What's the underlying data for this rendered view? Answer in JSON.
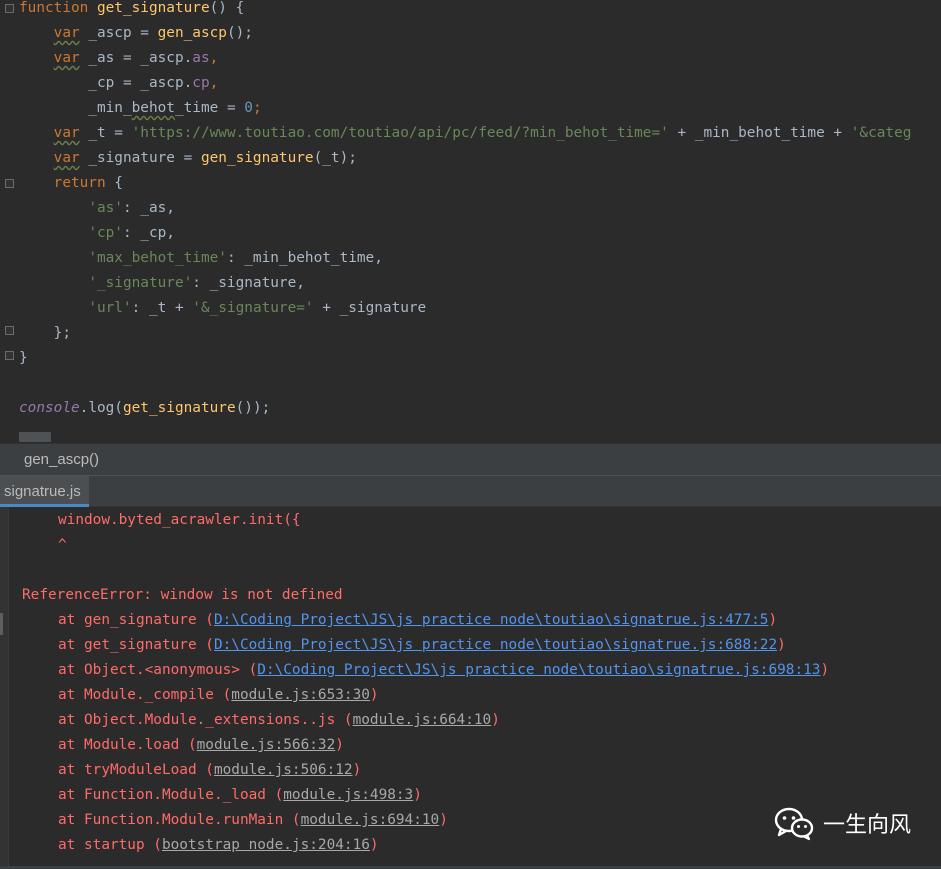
{
  "editor": {
    "lines": [
      {
        "parts": [
          {
            "t": "function ",
            "c": "kw"
          },
          {
            "t": "get_signature",
            "c": "fn"
          },
          {
            "t": "() {",
            "c": ""
          }
        ]
      },
      {
        "parts": [
          {
            "t": "    ",
            "c": ""
          },
          {
            "t": "var",
            "c": "kw wavy"
          },
          {
            "t": " _ascp = ",
            "c": ""
          },
          {
            "t": "gen_ascp",
            "c": "fn"
          },
          {
            "t": "();",
            "c": ""
          }
        ]
      },
      {
        "parts": [
          {
            "t": "    ",
            "c": ""
          },
          {
            "t": "var",
            "c": "kw wavy"
          },
          {
            "t": " _as = _ascp.",
            "c": ""
          },
          {
            "t": "as",
            "c": "prop"
          },
          {
            "t": ",",
            "c": "kw"
          }
        ]
      },
      {
        "parts": [
          {
            "t": "        _cp = _ascp.",
            "c": ""
          },
          {
            "t": "cp",
            "c": "prop"
          },
          {
            "t": ",",
            "c": "kw"
          }
        ]
      },
      {
        "parts": [
          {
            "t": "        _min_",
            "c": ""
          },
          {
            "t": "behot",
            "c": "wavy"
          },
          {
            "t": "_time = ",
            "c": ""
          },
          {
            "t": "0",
            "c": "num"
          },
          {
            "t": ";",
            "c": "kw"
          }
        ]
      },
      {
        "parts": [
          {
            "t": "    ",
            "c": ""
          },
          {
            "t": "var",
            "c": "kw wavy"
          },
          {
            "t": " _t = ",
            "c": ""
          },
          {
            "t": "'https://www.toutiao.com/toutiao/api/pc/feed/?min_behot_time='",
            "c": "str"
          },
          {
            "t": " + _min_behot_time + ",
            "c": ""
          },
          {
            "t": "'&categ",
            "c": "str"
          }
        ]
      },
      {
        "parts": [
          {
            "t": "    ",
            "c": ""
          },
          {
            "t": "var",
            "c": "kw wavy"
          },
          {
            "t": " _signature = ",
            "c": ""
          },
          {
            "t": "gen_signature",
            "c": "fn"
          },
          {
            "t": "(_t);",
            "c": ""
          }
        ]
      },
      {
        "parts": [
          {
            "t": "    ",
            "c": ""
          },
          {
            "t": "return",
            "c": "kw"
          },
          {
            "t": " {",
            "c": ""
          }
        ]
      },
      {
        "parts": [
          {
            "t": "        ",
            "c": ""
          },
          {
            "t": "'as'",
            "c": "str"
          },
          {
            "t": ": _as,",
            "c": ""
          }
        ]
      },
      {
        "parts": [
          {
            "t": "        ",
            "c": ""
          },
          {
            "t": "'cp'",
            "c": "str"
          },
          {
            "t": ": _cp,",
            "c": ""
          }
        ]
      },
      {
        "parts": [
          {
            "t": "        ",
            "c": ""
          },
          {
            "t": "'max_behot_time'",
            "c": "str"
          },
          {
            "t": ": _min_behot_time,",
            "c": ""
          }
        ]
      },
      {
        "parts": [
          {
            "t": "        ",
            "c": ""
          },
          {
            "t": "'_signature'",
            "c": "str"
          },
          {
            "t": ": _signature,",
            "c": ""
          }
        ]
      },
      {
        "parts": [
          {
            "t": "        ",
            "c": ""
          },
          {
            "t": "'url'",
            "c": "str"
          },
          {
            "t": ": _t + ",
            "c": ""
          },
          {
            "t": "'&_signature='",
            "c": "str"
          },
          {
            "t": " + _signature",
            "c": ""
          }
        ]
      },
      {
        "parts": [
          {
            "t": "    };",
            "c": ""
          }
        ]
      },
      {
        "parts": [
          {
            "t": "}",
            "c": ""
          }
        ]
      },
      {
        "parts": [
          {
            "t": "",
            "c": ""
          }
        ]
      },
      {
        "parts": [
          {
            "t": "console",
            "c": "con"
          },
          {
            "t": ".log(",
            "c": ""
          },
          {
            "t": "get_signature",
            "c": "fn"
          },
          {
            "t": "());",
            "c": ""
          }
        ]
      }
    ]
  },
  "breadcrumb": {
    "label": "gen_ascp()"
  },
  "run_tab": {
    "label": "signatrue.js"
  },
  "console": {
    "lines": [
      {
        "indent": "    ",
        "parts": [
          {
            "t": "window.byted_acrawler.init({",
            "c": ""
          }
        ]
      },
      {
        "indent": "    ",
        "parts": [
          {
            "t": "^",
            "c": ""
          }
        ]
      },
      {
        "indent": "",
        "parts": [
          {
            "t": "",
            "c": ""
          }
        ]
      },
      {
        "indent": "",
        "parts": [
          {
            "t": "ReferenceError: window is not defined",
            "c": ""
          }
        ]
      },
      {
        "indent": "    ",
        "parts": [
          {
            "t": "at gen_signature (",
            "c": ""
          },
          {
            "t": "D:\\Coding Project\\JS\\js practice node\\toutiao\\signatrue.js:477:5",
            "c": "link"
          },
          {
            "t": ")",
            "c": ""
          }
        ]
      },
      {
        "indent": "    ",
        "parts": [
          {
            "t": "at get_signature (",
            "c": ""
          },
          {
            "t": "D:\\Coding Project\\JS\\js practice node\\toutiao\\signatrue.js:688:22",
            "c": "link"
          },
          {
            "t": ")",
            "c": ""
          }
        ]
      },
      {
        "indent": "    ",
        "parts": [
          {
            "t": "at Object.<anonymous> (",
            "c": ""
          },
          {
            "t": "D:\\Coding Project\\JS\\js practice node\\toutiao\\signatrue.js:698:13",
            "c": "link"
          },
          {
            "t": ")",
            "c": ""
          }
        ]
      },
      {
        "indent": "    ",
        "parts": [
          {
            "t": "at Module._compile (",
            "c": ""
          },
          {
            "t": "module.js:653:30",
            "c": "glink"
          },
          {
            "t": ")",
            "c": ""
          }
        ]
      },
      {
        "indent": "    ",
        "parts": [
          {
            "t": "at Object.Module._extensions..js (",
            "c": ""
          },
          {
            "t": "module.js:664:10",
            "c": "glink"
          },
          {
            "t": ")",
            "c": ""
          }
        ]
      },
      {
        "indent": "    ",
        "parts": [
          {
            "t": "at Module.load (",
            "c": ""
          },
          {
            "t": "module.js:566:32",
            "c": "glink"
          },
          {
            "t": ")",
            "c": ""
          }
        ]
      },
      {
        "indent": "    ",
        "parts": [
          {
            "t": "at tryModuleLoad (",
            "c": ""
          },
          {
            "t": "module.js:506:12",
            "c": "glink"
          },
          {
            "t": ")",
            "c": ""
          }
        ]
      },
      {
        "indent": "    ",
        "parts": [
          {
            "t": "at Function.Module._load (",
            "c": ""
          },
          {
            "t": "module.js:498:3",
            "c": "glink"
          },
          {
            "t": ")",
            "c": ""
          }
        ]
      },
      {
        "indent": "    ",
        "parts": [
          {
            "t": "at Function.Module.runMain (",
            "c": ""
          },
          {
            "t": "module.js:694:10",
            "c": "glink"
          },
          {
            "t": ")",
            "c": ""
          }
        ]
      },
      {
        "indent": "    ",
        "parts": [
          {
            "t": "at startup (",
            "c": ""
          },
          {
            "t": "bootstrap node.js:204:16",
            "c": "glink"
          },
          {
            "t": ")",
            "c": ""
          }
        ]
      }
    ]
  },
  "watermark": {
    "text": "一生向风",
    "icon": "wechat-icon"
  }
}
